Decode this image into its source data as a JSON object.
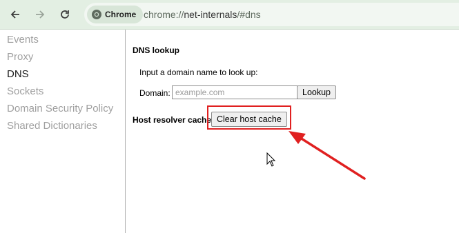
{
  "toolbar": {
    "back_icon": "arrow-left-icon",
    "forward_icon": "arrow-right-icon",
    "reload_icon": "reload-icon",
    "chip_label": "Chrome",
    "url_scheme": "chrome://",
    "url_host": "net-internals",
    "url_path": "/#dns"
  },
  "sidebar": {
    "items": [
      {
        "label": "Events",
        "active": false
      },
      {
        "label": "Proxy",
        "active": false
      },
      {
        "label": "DNS",
        "active": true
      },
      {
        "label": "Sockets",
        "active": false
      },
      {
        "label": "Domain Security Policy",
        "active": false
      },
      {
        "label": "Shared Dictionaries",
        "active": false
      }
    ]
  },
  "dns": {
    "section_title": "DNS lookup",
    "instruction": "Input a domain name to look up:",
    "domain_label": "Domain:",
    "domain_placeholder": "example.com",
    "domain_value": "",
    "lookup_label": "Lookup",
    "cache_title": "Host resolver cache",
    "clear_cache_label": "Clear host cache"
  },
  "colors": {
    "toolbar_bg": "#e3efe3",
    "highlight": "#e02020",
    "active_text": "#1a1a1a",
    "inactive_text": "#a0a0a0"
  }
}
